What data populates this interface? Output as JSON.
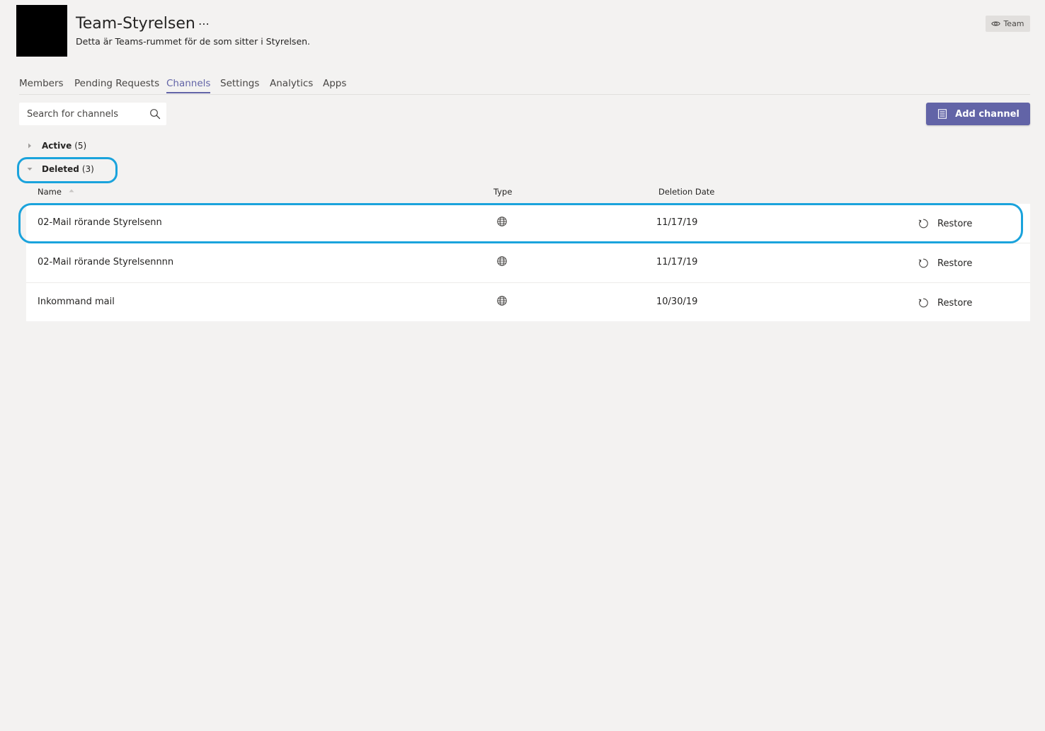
{
  "header": {
    "title": "Team-Styrelsen",
    "more_label": "⋯",
    "description": "Detta är Teams-rummet för de som sitter i Styrelsen.",
    "badge_label": "Team",
    "badge_icon": "eye-icon"
  },
  "tabs": [
    {
      "label": "Members",
      "active": false
    },
    {
      "label": "Pending Requests",
      "active": false
    },
    {
      "label": "Channels",
      "active": true
    },
    {
      "label": "Settings",
      "active": false
    },
    {
      "label": "Analytics",
      "active": false
    },
    {
      "label": "Apps",
      "active": false
    }
  ],
  "search": {
    "placeholder": "Search for channels",
    "value": "",
    "icon": "search-icon"
  },
  "add_channel": {
    "label": "Add channel",
    "icon": "add-channel-icon"
  },
  "sections": {
    "active": {
      "label": "Active",
      "count": "(5)",
      "expanded": false
    },
    "deleted": {
      "label": "Deleted",
      "count": "(3)",
      "expanded": true
    }
  },
  "table": {
    "columns": {
      "name": "Name",
      "type": "Type",
      "deletion_date": "Deletion Date"
    },
    "sort": "name-ascending",
    "rows": [
      {
        "name": "02-Mail rörande Styrelsenn",
        "type_icon": "globe-icon",
        "date": "11/17/19",
        "action": "Restore"
      },
      {
        "name": "02-Mail rörande Styrelsennnn",
        "type_icon": "globe-icon",
        "date": "11/17/19",
        "action": "Restore"
      },
      {
        "name": "Inkommand mail",
        "type_icon": "globe-icon",
        "date": "10/30/19",
        "action": "Restore"
      }
    ]
  },
  "colors": {
    "accent": "#6264a7",
    "highlight": "#1aa3dc",
    "background": "#f3f2f1"
  }
}
